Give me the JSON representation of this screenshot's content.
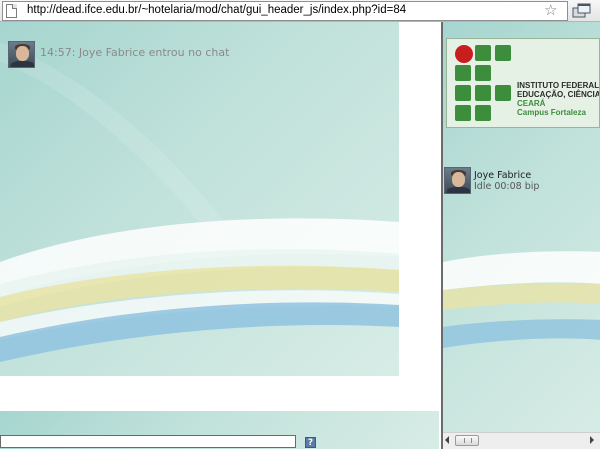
{
  "browser": {
    "url": "http://dead.ifce.edu.br/~hotelaria/mod/chat/gui_header_js/index.php?id=84",
    "icons": [
      "page-icon",
      "star-icon",
      "menu-icon"
    ]
  },
  "chat": {
    "messages": [
      {
        "time": "14:57:",
        "text": "Joye Fabrice entrou no chat",
        "icon": "avatar"
      }
    ],
    "input": {
      "value": "",
      "help_icon": "?"
    }
  },
  "sidebar": {
    "logo": {
      "lines": [
        "INSTITUTO FEDERAL DO",
        "EDUCAÇÃO, CIÊNCIA E",
        "CEARÁ",
        "Campus Fortaleza"
      ],
      "colors": {
        "squares": "#3c8d3c",
        "dot": "#c81e1e"
      }
    },
    "users": [
      {
        "name": "Joye Fabrice",
        "status": "Idle 00:08",
        "action": "bip"
      }
    ]
  }
}
